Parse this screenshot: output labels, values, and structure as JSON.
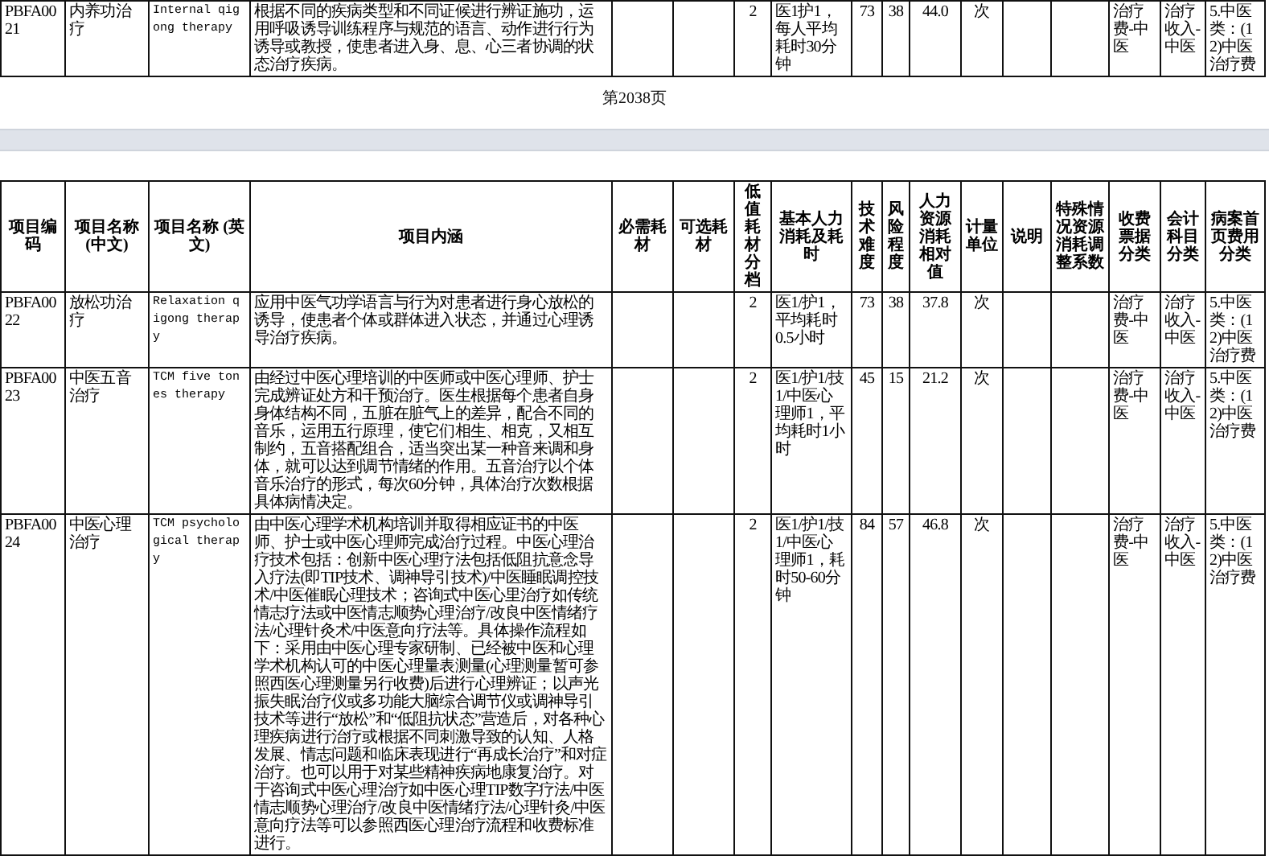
{
  "columns": [
    "项目编码",
    "项目名称 (中文)",
    "项目名称 (英文)",
    "项目内涵",
    "必需耗材",
    "可选耗材",
    "低值耗材分档",
    "基本人力消耗及耗时",
    "技术难度",
    "风险程度",
    "人力资源消耗相对值",
    "计量单位",
    "说明",
    "特殊情况资源消耗调整系数",
    "收费票据分类",
    "会计科目分类",
    "病案首页费用分类"
  ],
  "previous_page": {
    "rows": [
      {
        "code": "PBFA0021",
        "name_zh": "内养功治疗",
        "name_en": "Internal qigong therapy",
        "content": "根据不同的疾病类型和不同证候进行辨证施功，运用呼吸诱导训练程序与规范的语言、动作进行行为诱导或教授，使患者进入身、息、心三者协调的状态治疗疾病。",
        "low_value_tier": "2",
        "staffing": "医1护1，每人平均耗时30分钟",
        "difficulty": "73",
        "risk": "38",
        "labor_value": "44.0",
        "unit": "次",
        "fee_category": "治疗费-中医",
        "accounting_category": "治疗收入-中医",
        "case_category": "5.中医类：(12)中医治疗费"
      }
    ],
    "page_number": "第2038页"
  },
  "page": {
    "rows": [
      {
        "code": "PBFA0022",
        "name_zh": "放松功治疗",
        "name_en": "Relaxation qigong therapy",
        "content": "应用中医气功学语言与行为对患者进行身心放松的诱导，使患者个体或群体进入状态，并通过心理诱导治疗疾病。",
        "low_value_tier": "2",
        "staffing": "医1/护1，平均耗时0.5小时",
        "difficulty": "73",
        "risk": "38",
        "labor_value": "37.8",
        "unit": "次",
        "fee_category": "治疗费-中医",
        "accounting_category": "治疗收入-中医",
        "case_category": "5.中医类：(12)中医治疗费"
      },
      {
        "code": "PBFA0023",
        "name_zh": "中医五音治疗",
        "name_en": "TCM five tones therapy",
        "content": "由经过中医心理培训的中医师或中医心理师、护士完成辨证处方和干预治疗。医生根据每个患者自身身体结构不同，五脏在脏气上的差异，配合不同的音乐，运用五行原理，使它们相生、相克，又相互制约，五音搭配组合，适当突出某一种音来调和身体，就可以达到调节情绪的作用。五音治疗以个体音乐治疗的形式，每次60分钟，具体治疗次数根据具体病情决定。",
        "low_value_tier": "2",
        "staffing": "医1/护1/技1/中医心理师1，平均耗时1小时",
        "difficulty": "45",
        "risk": "15",
        "labor_value": "21.2",
        "unit": "次",
        "fee_category": "治疗费-中医",
        "accounting_category": "治疗收入-中医",
        "case_category": "5.中医类：(12)中医治疗费"
      },
      {
        "code": "PBFA0024",
        "name_zh": "中医心理治疗",
        "name_en": "TCM psychological therapy",
        "content": "由中医心理学术机构培训并取得相应证书的中医师、护士或中医心理师完成治疗过程。中医心理治疗技术包括：创新中医心理疗法包括低阻抗意念导入疗法(即TIP技术、调神导引技术)/中医睡眠调控技术/中医催眠心理技术；咨询式中医心里治疗如传统情志疗法或中医情志顺势心理治疗/改良中医情绪疗法/心理针灸术/中医意向疗法等。具体操作流程如下：采用由中医心理专家研制、已经被中医和心理学术机构认可的中医心理量表测量(心理测量暂可参照西医心理测量另行收费)后进行心理辨证；以声光振失眠治疗仪或多功能大脑综合调节仪或调神导引技术等进行“放松”和“低阻抗状态”营造后，对各种心理疾病进行治疗或根据不同刺激导致的认知、人格发展、情志问题和临床表现进行“再成长治疗”和对症治疗。也可以用于对某些精神疾病地康复治疗。对于咨询式中医心理治疗如中医心理TIP数字疗法/中医情志顺势心理治疗/改良中医情绪疗法/心理针灸/中医意向疗法等可以参照西医心理治疗流程和收费标准进行。",
        "low_value_tier": "2",
        "staffing": "医1/护1/技1/中医心理师1，耗时50-60分钟",
        "difficulty": "84",
        "risk": "57",
        "labor_value": "46.8",
        "unit": "次",
        "fee_category": "治疗费-中医",
        "accounting_category": "治疗收入-中医",
        "case_category": "5.中医类：(12)中医治疗费"
      }
    ]
  }
}
